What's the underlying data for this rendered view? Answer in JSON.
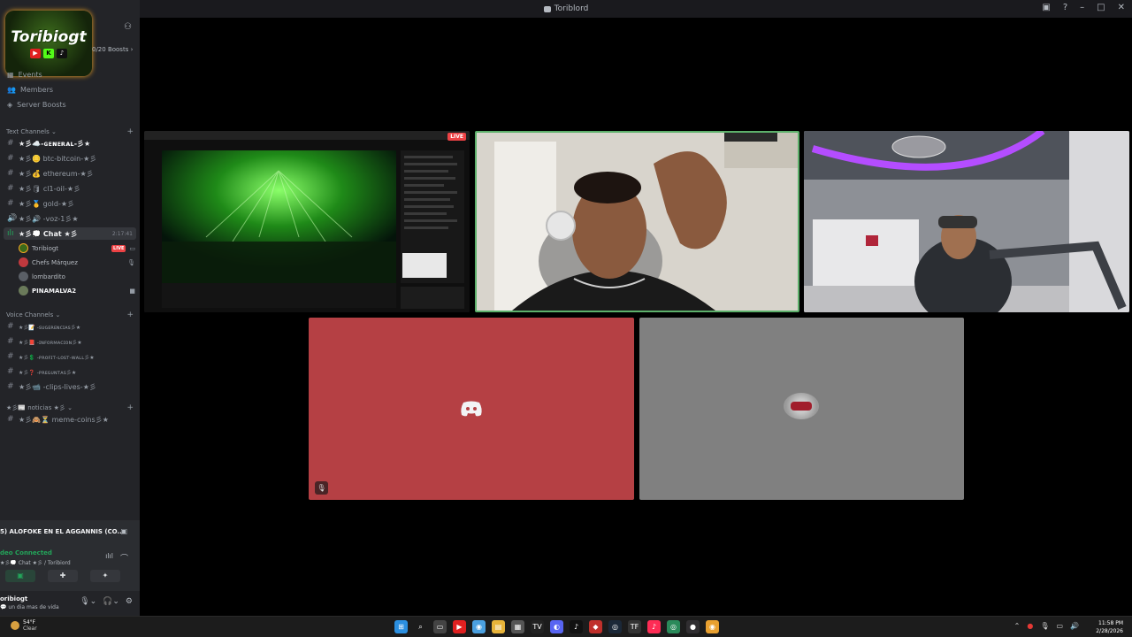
{
  "window": {
    "title": "Toriblord"
  },
  "server": {
    "logo_text": "Toribiogt",
    "boosts": "0/20 Boosts",
    "nav": [
      {
        "label": "Events",
        "icon": "calendar-icon"
      },
      {
        "label": "Members",
        "icon": "members-icon"
      },
      {
        "label": "Server Boosts",
        "icon": "boost-icon"
      }
    ]
  },
  "categories": {
    "text": "Text Channels",
    "voice": "Voice Channels",
    "noticias": "★彡📰 noticias ★彡"
  },
  "text_channels": [
    {
      "label": "★彡☁️-ɢᴇɴᴇʀᴀʟ-彡★"
    },
    {
      "label": "★彡🪙 btc-bitcoin-★彡"
    },
    {
      "label": "★彡💰 ethereum-★彡"
    },
    {
      "label": "★彡🛢 cl1-oil-★彡"
    },
    {
      "label": "★彡🥇 gold-★彡"
    },
    {
      "label": "★彡🔊 -voz-1彡★"
    },
    {
      "label": "★彡💭 Chat ★彡",
      "time": "2:17:41"
    }
  ],
  "voice_users": [
    {
      "name": "Toribiogt",
      "badge": "LIVE",
      "color": "#3a6a1a"
    },
    {
      "name": "Chefs Márquez",
      "color": "#c0393e"
    },
    {
      "name": "lombardito",
      "color": "#5a5f66"
    },
    {
      "name": "PINAMALVA2",
      "color": "#6a7a5a"
    }
  ],
  "voice_channels": [
    {
      "label": "★彡📝 -ꜱᴜɢᴇʀᴇɴᴄɪᴀꜱ彡★"
    },
    {
      "label": "★彡📕 -ɪɴꜰᴏʀᴍᴀᴄɪᴏɴ彡★"
    },
    {
      "label": "★彡💲 -ᴘʀᴏꜰɪᴛ-ʟᴏꜱᴛ-ᴡᴀʟʟ彡★"
    },
    {
      "label": "★彡❓ -ᴘʀᴇɢᴜɴᴛᴀꜱ彡★"
    },
    {
      "label": "★彡📹 -clips-lives-★彡"
    }
  ],
  "noticias_channels": [
    {
      "label": "★彡🙈⏳ meme-coins彡★"
    }
  ],
  "rtc": {
    "stream_title": "5) ALOFOKE EN EL AGGANNIS (CO...",
    "status": "deo Connected",
    "location": "★彡💭 Chat ★彡 / Toribiord"
  },
  "user_panel": {
    "name": "oribiogt",
    "status": "un dia mas de vida"
  },
  "tiles": {
    "live_badge": "LIVE"
  },
  "taskbar": {
    "temp": "54°F",
    "condition": "Clear",
    "time": "11:58 PM",
    "date": "2/28/2026"
  },
  "colors": {
    "accent_green": "#23a55a",
    "live_red": "#ed4245",
    "tile_red": "#b54044",
    "tile_grey": "#808080"
  }
}
